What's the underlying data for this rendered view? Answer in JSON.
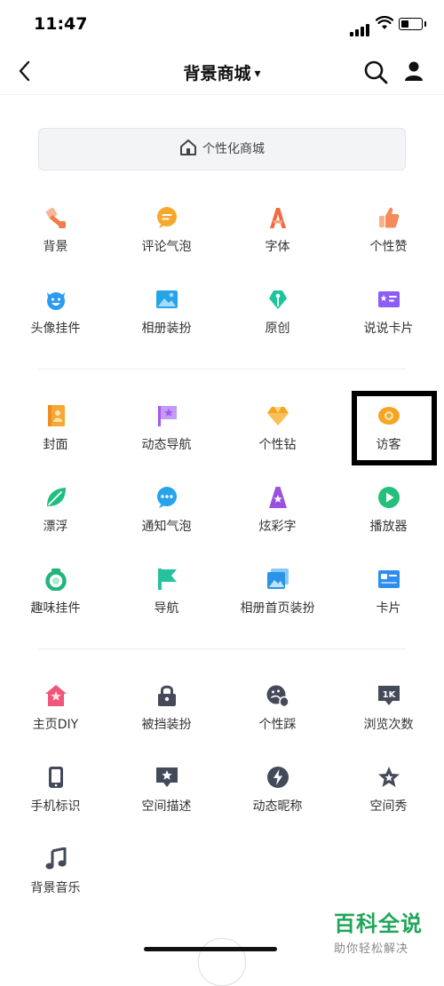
{
  "status": {
    "time": "11:47"
  },
  "nav": {
    "title": "背景商城",
    "caret": "▾"
  },
  "shop_bar": {
    "label": "个性化商城"
  },
  "section1": [
    {
      "label": "背景",
      "icon": "brush-icon",
      "color": "#f37a4a"
    },
    {
      "label": "评论气泡",
      "icon": "chat-bubble-icon",
      "color": "#f7a82c"
    },
    {
      "label": "字体",
      "icon": "letter-a-icon",
      "color": "#f36a3e"
    },
    {
      "label": "个性赞",
      "icon": "thumbs-up-icon",
      "color": "#f58a5c"
    },
    {
      "label": "头像挂件",
      "icon": "face-icon",
      "color": "#2d9cf0"
    },
    {
      "label": "相册装扮",
      "icon": "photo-icon",
      "color": "#25a5e8"
    },
    {
      "label": "原创",
      "icon": "pen-nib-icon",
      "color": "#20c49a"
    },
    {
      "label": "说说卡片",
      "icon": "card-icon",
      "color": "#8b5cf6"
    }
  ],
  "section2": [
    {
      "label": "封面",
      "icon": "cover-icon",
      "color": "#f5a833"
    },
    {
      "label": "动态导航",
      "icon": "star-flag-icon",
      "color": "#a855f7"
    },
    {
      "label": "个性钻",
      "icon": "diamond-icon",
      "color": "#f5a524"
    },
    {
      "label": "访客",
      "icon": "eye-icon",
      "color": "#f5a524"
    },
    {
      "label": "漂浮",
      "icon": "leaf-icon",
      "color": "#1fbf7f"
    },
    {
      "label": "通知气泡",
      "icon": "dots-bubble-icon",
      "color": "#27a3ec"
    },
    {
      "label": "炫彩字",
      "icon": "star-a-icon",
      "color": "#9b51e0"
    },
    {
      "label": "播放器",
      "icon": "play-icon",
      "color": "#22c07a"
    },
    {
      "label": "趣味挂件",
      "icon": "ring-icon",
      "color": "#20b67a"
    },
    {
      "label": "导航",
      "icon": "flag-icon",
      "color": "#25c2a0"
    },
    {
      "label": "相册首页装扮",
      "icon": "album-icon",
      "color": "#2a95e8"
    },
    {
      "label": "卡片",
      "icon": "id-card-icon",
      "color": "#2d8ef0"
    }
  ],
  "section3": [
    {
      "label": "主页DIY",
      "icon": "home-star-icon",
      "color": "#f0567a"
    },
    {
      "label": "被挡装扮",
      "icon": "lock-icon",
      "color": "#444a5a"
    },
    {
      "label": "个性踩",
      "icon": "footprint-icon",
      "color": "#444a5a"
    },
    {
      "label": "浏览次数",
      "icon": "count-1k-icon",
      "color": "#444a5a",
      "badge": "1K"
    },
    {
      "label": "手机标识",
      "icon": "phone-icon",
      "color": "#444a5a"
    },
    {
      "label": "空间描述",
      "icon": "star-bubble-icon",
      "color": "#444a5a"
    },
    {
      "label": "动态昵称",
      "icon": "bolt-icon",
      "color": "#444a5a"
    },
    {
      "label": "空间秀",
      "icon": "star-outline-icon",
      "color": "#444a5a"
    },
    {
      "label": "背景音乐",
      "icon": "music-note-icon",
      "color": "#444a5a"
    }
  ],
  "watermark": {
    "title": "百科全说",
    "subtitle": "助你轻松解决"
  }
}
